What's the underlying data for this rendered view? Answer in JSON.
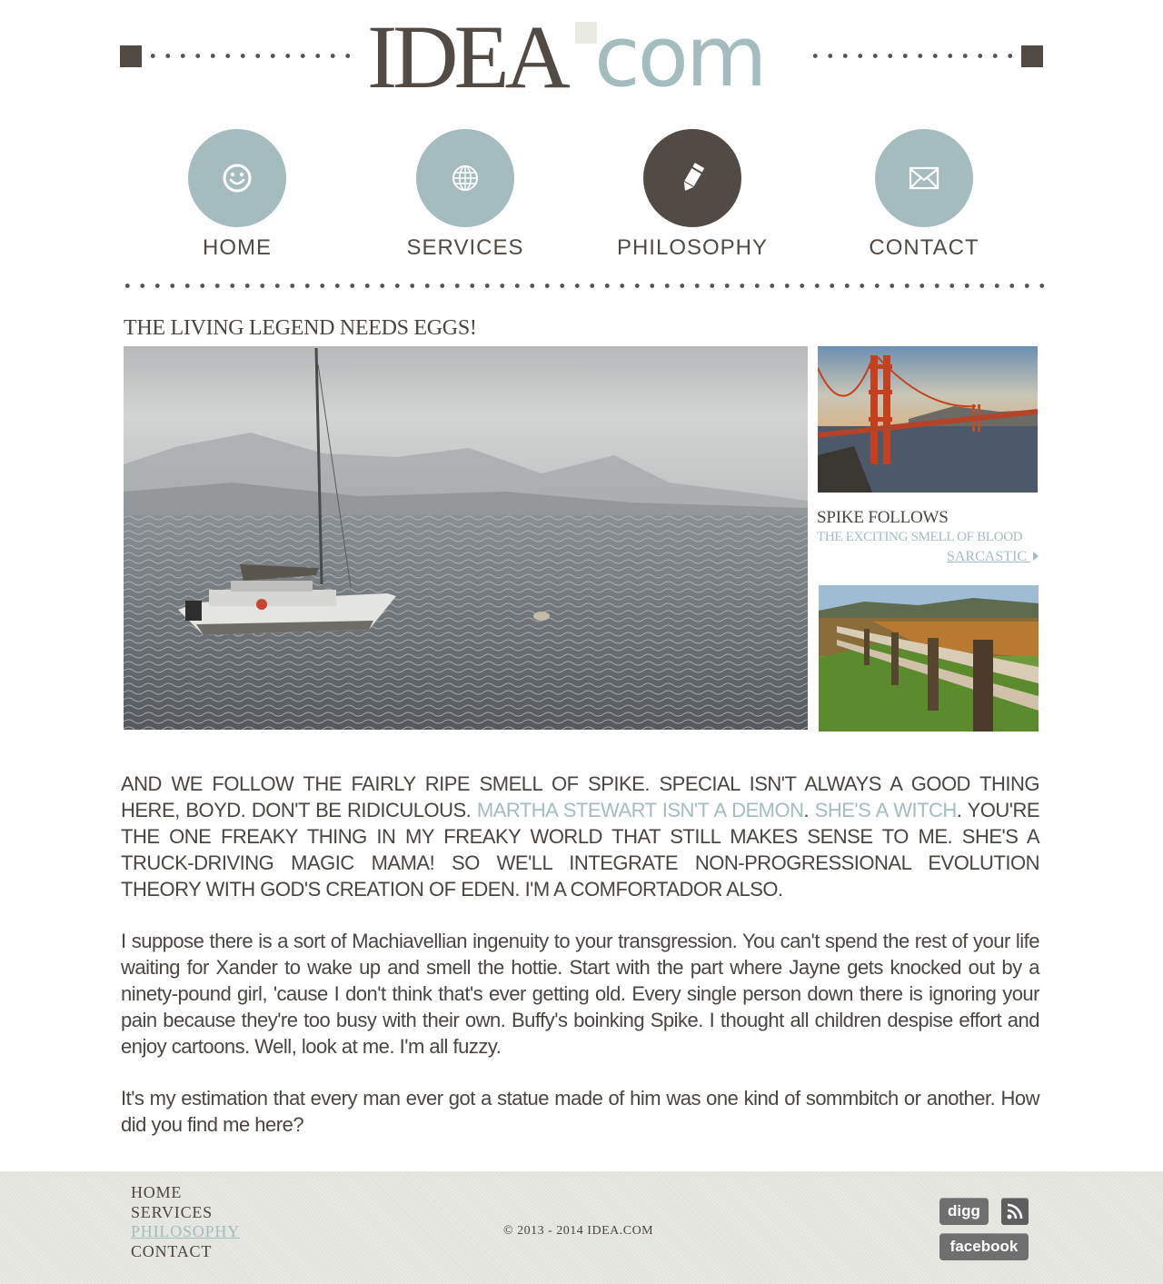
{
  "logo": {
    "idea": "IDEA",
    "com": "com"
  },
  "nav": {
    "items": [
      {
        "label": "HOME",
        "icon": "smiley-icon"
      },
      {
        "label": "SERVICES",
        "icon": "globe-icon"
      },
      {
        "label": "PHILOSOPHY",
        "icon": "pencil-icon",
        "active": true
      },
      {
        "label": "CONTACT",
        "icon": "envelope-icon"
      }
    ]
  },
  "article": {
    "title": "THE LIVING LEGEND NEEDS EGGS!",
    "lead_part1": "AND WE FOLLOW THE FAIRLY RIPE SMELL OF SPIKE. SPECIAL ISN'T ALWAYS A GOOD THING HERE, BOYD. DON'T BE RIDICULOUS. ",
    "lead_link1": "MARTHA STEWART ISN'T A DEMON",
    "lead_sep": ". ",
    "lead_link2": "SHE'S A WITCH",
    "lead_part2": ". YOU'RE THE ONE FREAKY THING IN MY FREAKY WORLD THAT STILL MAKES SENSE TO ME. SHE'S A TRUCK-DRIVING MAGIC MAMA! SO WE'LL INTEGRATE NON-PROGRESSIONAL EVOLUTION THEORY WITH GOD'S CREATION OF EDEN. I'M A COMFORTADOR ALSO.",
    "paragraph2": "I suppose there is a sort of Machiavellian ingenuity to your transgression. You can't spend the rest of your life waiting for Xander to wake up and smell the hottie. Start with the part where Jayne gets knocked out by a ninety-pound girl, 'cause I don't think that's ever getting old. Every single person down there is ignoring your pain because they're too busy with their own. Buffy's boinking Spike. I thought all children despise effort and enjoy cartoons. Well, look at me. I'm all fuzzy.",
    "paragraph3": "It's my estimation that every man ever got a statue made of him was one kind of sommbitch or another. How did you find me here?"
  },
  "sidebar": {
    "title": "SPIKE FOLLOWS",
    "subtitle": "THE EXCITING SMELL OF BLOOD",
    "link": "SARCASTIC"
  },
  "footer": {
    "nav": [
      "HOME",
      "SERVICES",
      "PHILOSOPHY",
      "CONTACT"
    ],
    "active_index": 2,
    "copyright": "© 2013 - 2014 IDEA.COM",
    "social": {
      "digg": "digg",
      "facebook": "facebook",
      "rss_icon": "rss-icon"
    }
  },
  "colors": {
    "accent": "#a4bcbd",
    "dark": "#524a44",
    "text": "#4b4540",
    "footer_bg": "#e3e3de"
  }
}
